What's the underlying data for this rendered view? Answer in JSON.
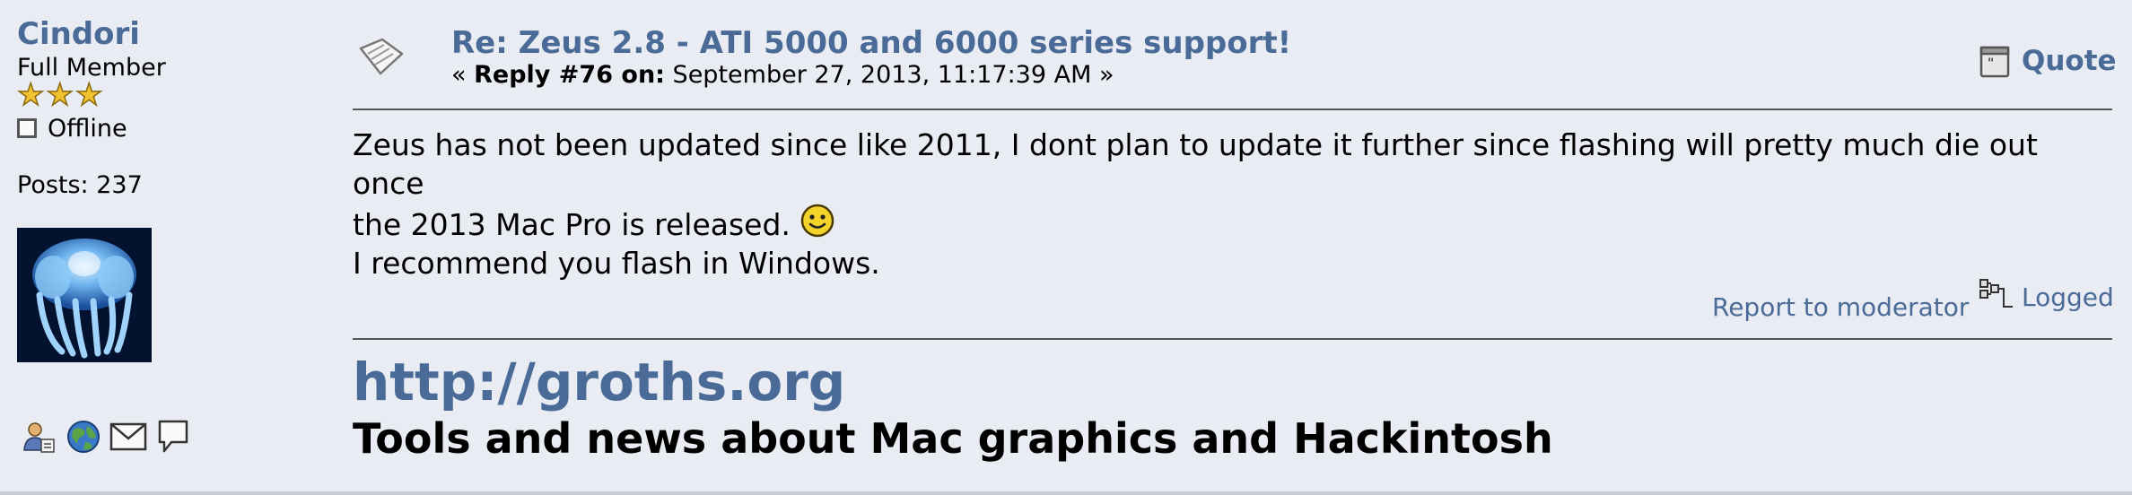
{
  "poster": {
    "username": "Cindori",
    "rank": "Full Member",
    "star_count": 3,
    "status": "Offline",
    "posts": "Posts: 237",
    "contact_icons": [
      "profile-icon",
      "globe-icon",
      "email-icon",
      "pm-icon"
    ]
  },
  "post": {
    "subject": "Re: Zeus 2.8 - ATI 5000 and 6000 series support!",
    "reply_prefix": "« ",
    "reply_label": "Reply #76 on:",
    "reply_date": " September 27, 2013, 11:17:39 AM »",
    "quote_label": "Quote",
    "body_line1": "Zeus has not been updated since like 2011, I dont plan to update it further since flashing will pretty much die out once",
    "body_line2": "the 2013 Mac Pro is released.",
    "body_line3": "I recommend you flash in Windows.",
    "report_label": "Report to moderator",
    "logged_label": "Logged"
  },
  "signature": {
    "link": "http://groths.org",
    "tagline": "Tools and news about Mac graphics and Hackintosh"
  },
  "colors": {
    "link": "#4a6a98",
    "background": "#e9ecf2",
    "star": "#f2c230"
  }
}
